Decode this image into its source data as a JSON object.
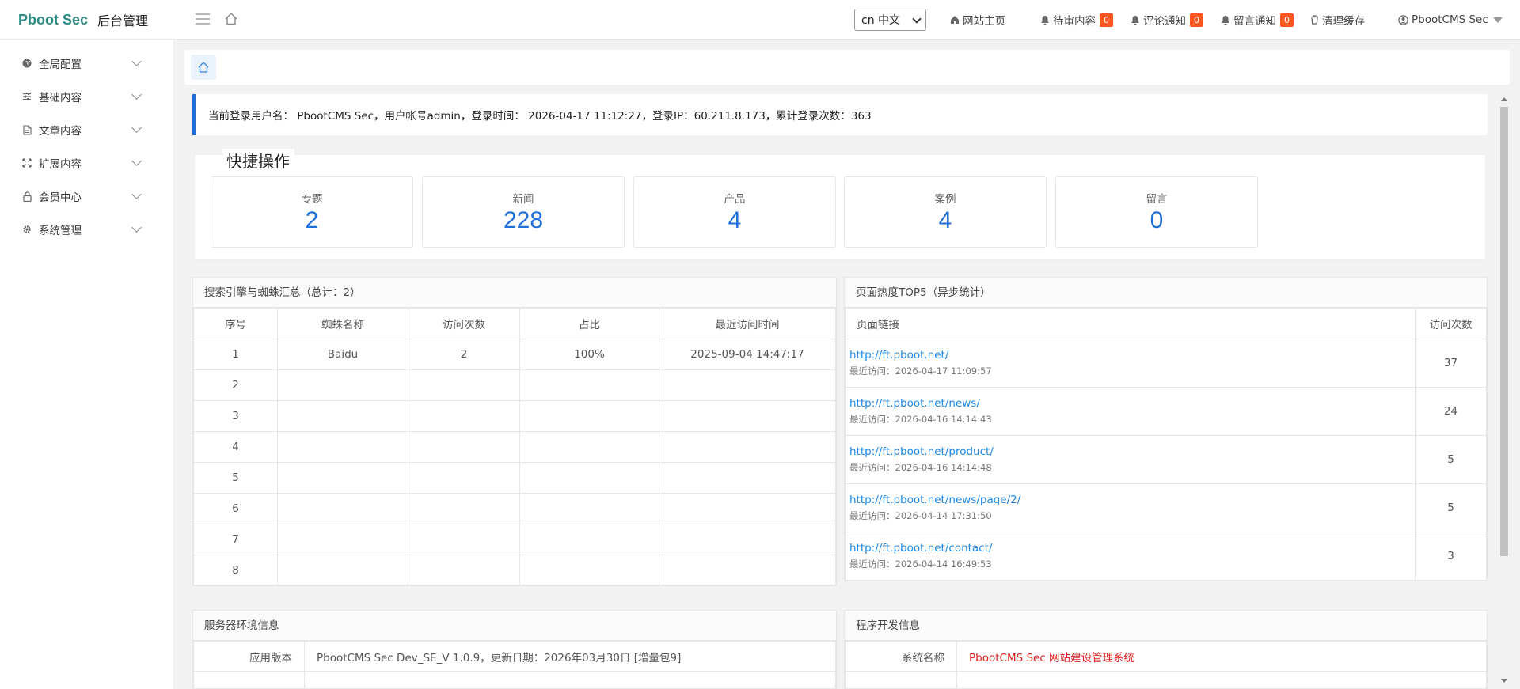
{
  "header": {
    "brand": "Pboot Sec",
    "subtitle": "后台管理",
    "language": "cn 中文",
    "links": {
      "site_home": "网站主页",
      "pending": "待审内容",
      "pending_count": "0",
      "comments": "评论通知",
      "comments_count": "0",
      "messages": "留言通知",
      "messages_count": "0",
      "clear_cache": "清理缓存",
      "user": "PbootCMS Sec"
    }
  },
  "sidebar": {
    "items": [
      {
        "label": "全局配置",
        "icon": "globe-icon"
      },
      {
        "label": "基础内容",
        "icon": "sliders-icon"
      },
      {
        "label": "文章内容",
        "icon": "file-icon"
      },
      {
        "label": "扩展内容",
        "icon": "expand-icon"
      },
      {
        "label": "会员中心",
        "icon": "lock-icon"
      },
      {
        "label": "系统管理",
        "icon": "gear-icon"
      }
    ]
  },
  "notice": "当前登录用户名： PbootCMS Sec，用户帐号admin，登录时间： 2026-04-17 11:12:27，登录IP：60.211.8.173，累计登录次数：363",
  "quick": {
    "title": "快捷操作",
    "cards": [
      {
        "label": "专题",
        "value": "2"
      },
      {
        "label": "新闻",
        "value": "228"
      },
      {
        "label": "产品",
        "value": "4"
      },
      {
        "label": "案例",
        "value": "4"
      },
      {
        "label": "留言",
        "value": "0"
      }
    ]
  },
  "spider": {
    "title": "搜索引擎与蜘蛛汇总（总计：2）",
    "headers": [
      "序号",
      "蜘蛛名称",
      "访问次数",
      "占比",
      "最近访问时间"
    ],
    "rows": [
      [
        "1",
        "Baidu",
        "2",
        "100%",
        "2025-09-04 14:47:17"
      ],
      [
        "2",
        "",
        "",
        "",
        ""
      ],
      [
        "3",
        "",
        "",
        "",
        ""
      ],
      [
        "4",
        "",
        "",
        "",
        ""
      ],
      [
        "5",
        "",
        "",
        "",
        ""
      ],
      [
        "6",
        "",
        "",
        "",
        ""
      ],
      [
        "7",
        "",
        "",
        "",
        ""
      ],
      [
        "8",
        "",
        "",
        "",
        ""
      ]
    ]
  },
  "hot": {
    "title": "页面热度TOP5（异步统计）",
    "headers": [
      "页面链接",
      "访问次数"
    ],
    "rows": [
      {
        "url": "http://ft.pboot.net/",
        "time": "最近访问：2026-04-17 11:09:57",
        "count": "37"
      },
      {
        "url": "http://ft.pboot.net/news/",
        "time": "最近访问：2026-04-16 14:14:43",
        "count": "24"
      },
      {
        "url": "http://ft.pboot.net/product/",
        "time": "最近访问：2026-04-16 14:14:48",
        "count": "5"
      },
      {
        "url": "http://ft.pboot.net/news/page/2/",
        "time": "最近访问：2026-04-14 17:31:50",
        "count": "5"
      },
      {
        "url": "http://ft.pboot.net/contact/",
        "time": "最近访问：2026-04-14 16:49:53",
        "count": "3"
      }
    ]
  },
  "server": {
    "title": "服务器环境信息",
    "version_label": "应用版本",
    "version_value": "PbootCMS Sec Dev_SE_V 1.0.9，更新日期：2026年03月30日 [增量包9]"
  },
  "program": {
    "title": "程序开发信息",
    "name_label": "系统名称",
    "name_value": "PbootCMS Sec 网站建设管理系统"
  },
  "colors": {
    "brand": "#2e8b84",
    "accent": "#1e6fd9",
    "badge": "#ff5722",
    "link": "#1e88e5",
    "red_text": "#e02020"
  }
}
